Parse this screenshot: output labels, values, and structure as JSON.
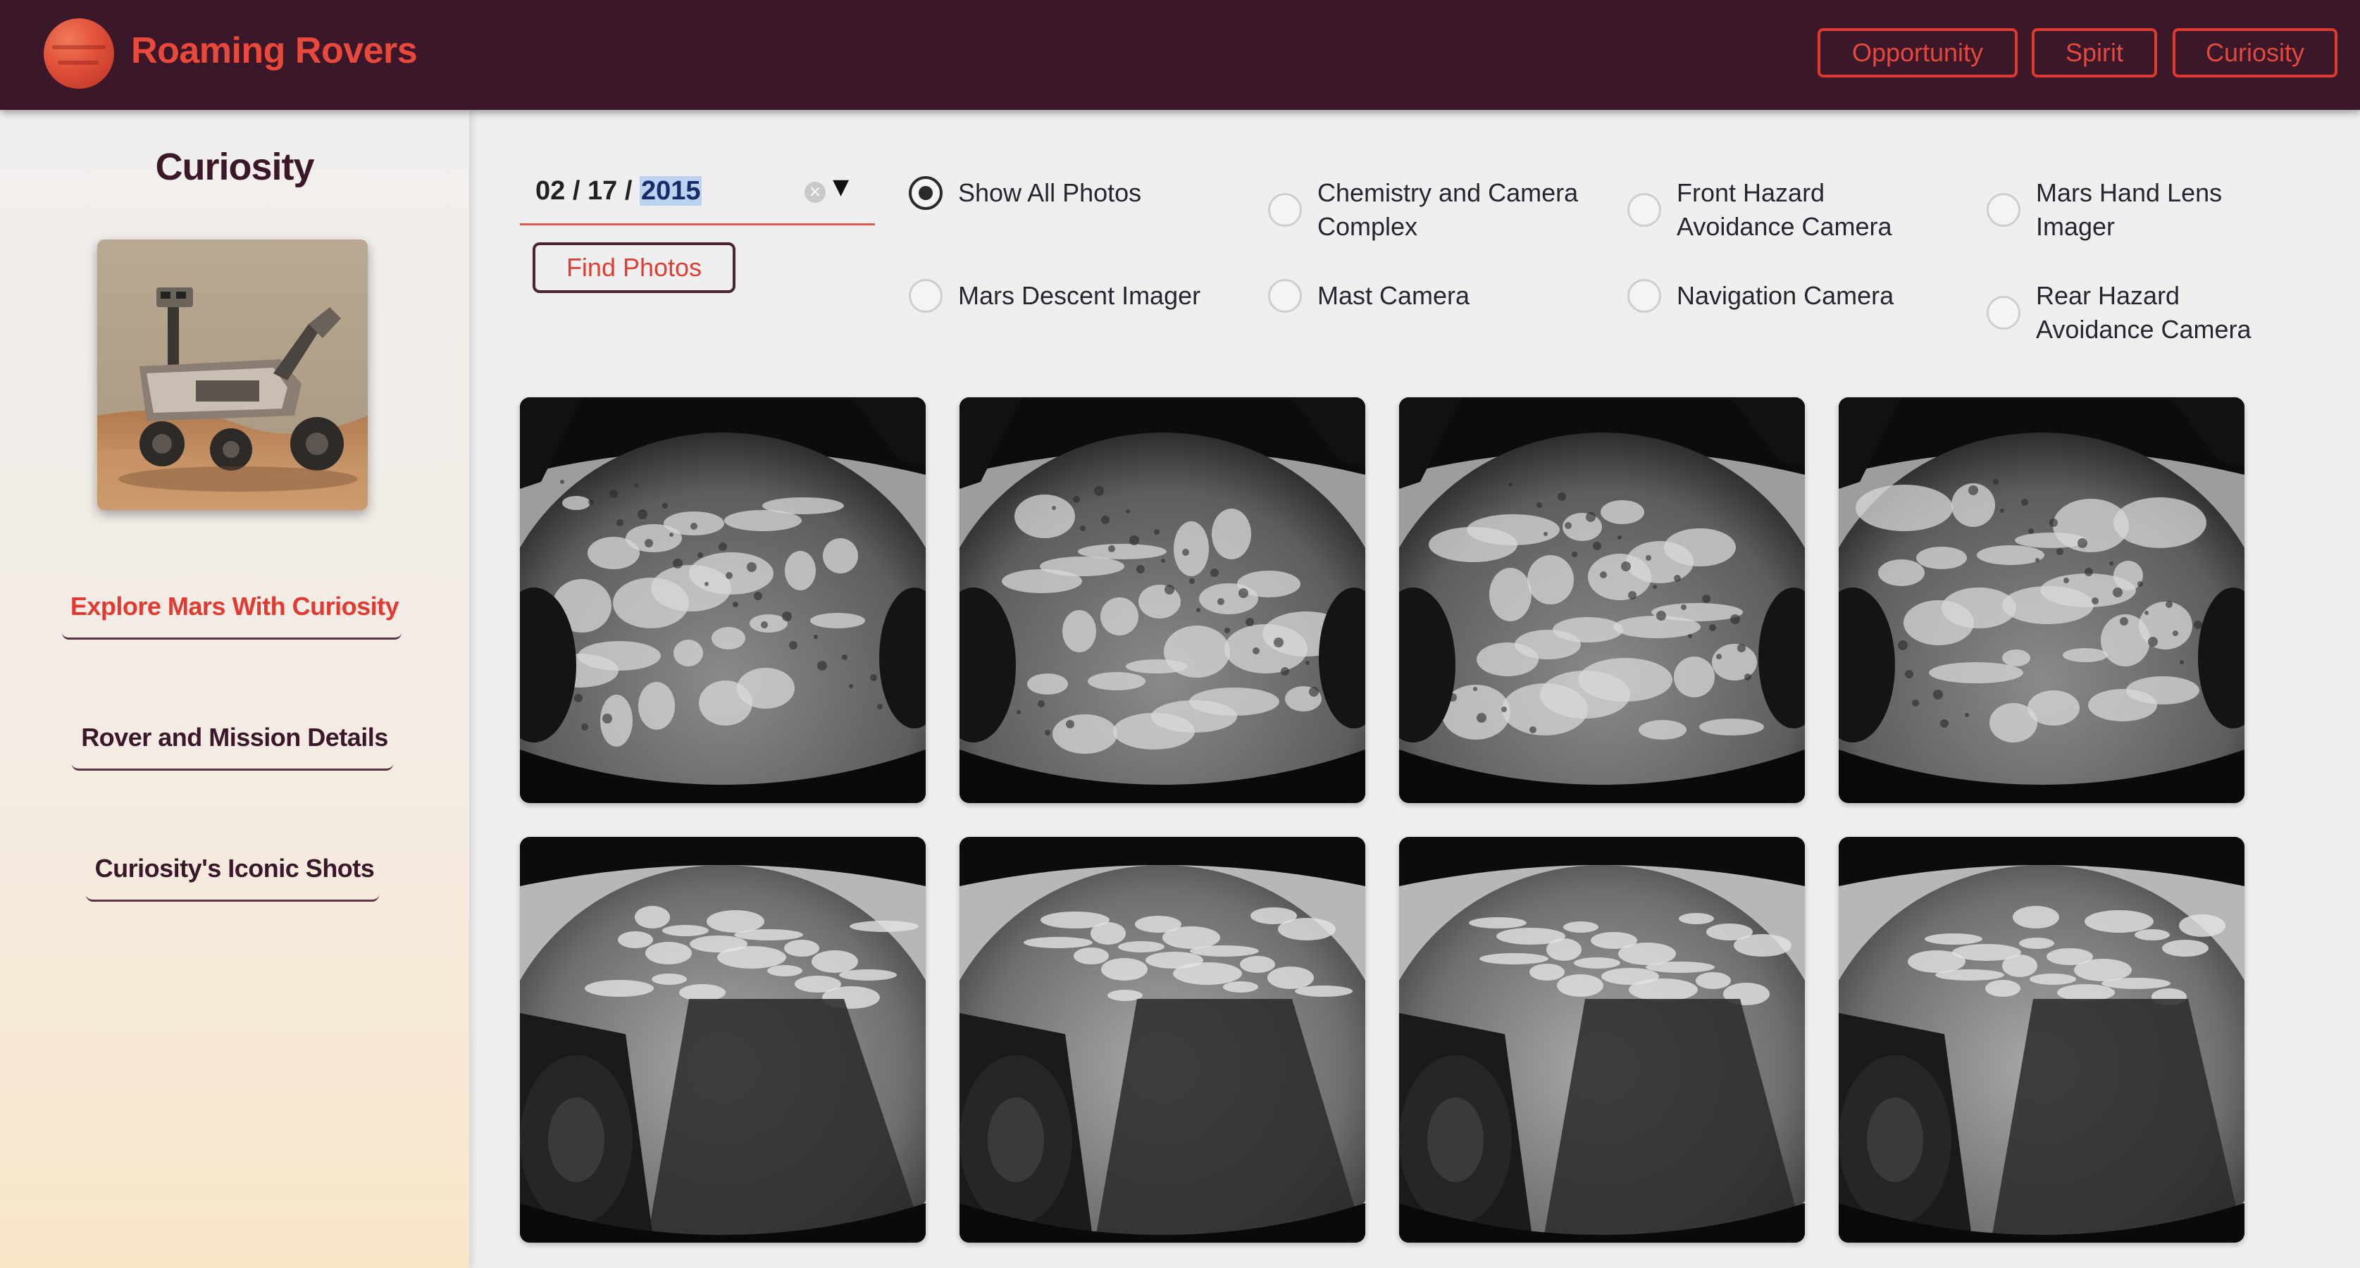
{
  "header": {
    "brand": "Roaming Rovers",
    "logo_icon": "mars-planet-icon",
    "nav": [
      {
        "label": "Opportunity"
      },
      {
        "label": "Spirit"
      },
      {
        "label": "Curiosity"
      }
    ]
  },
  "sidebar": {
    "rover_name": "Curiosity",
    "links": [
      {
        "label": "Explore Mars With Curiosity",
        "active": true
      },
      {
        "label": "Rover and Mission Details",
        "active": false
      },
      {
        "label": "Curiosity's Iconic Shots",
        "active": false
      }
    ]
  },
  "filters": {
    "date": {
      "month": "02",
      "day": "17",
      "year": "2015",
      "separator": "/"
    },
    "find_button": "Find Photos",
    "cameras": [
      {
        "label": "Show All Photos",
        "checked": true
      },
      {
        "label": "Chemistry and Camera Complex",
        "line1": "Chemistry and Camera",
        "line2": "Complex",
        "checked": false
      },
      {
        "label": "Front Hazard Avoidance Camera",
        "line1": "Front Hazard",
        "line2": "Avoidance Camera",
        "checked": false
      },
      {
        "label": "Mars Hand Lens Imager",
        "line1": "Mars Hand Lens",
        "line2": "Imager",
        "checked": false
      },
      {
        "label": "Mars Descent Imager",
        "checked": false
      },
      {
        "label": "Mast Camera",
        "checked": false
      },
      {
        "label": "Navigation Camera",
        "checked": false
      },
      {
        "label": "Rear Hazard Avoidance Camera",
        "line1": "Rear Hazard",
        "line2": "Avoidance Camera",
        "checked": false
      }
    ]
  },
  "photos": [
    {
      "kind": "hazcam-front"
    },
    {
      "kind": "hazcam-front"
    },
    {
      "kind": "hazcam-front"
    },
    {
      "kind": "hazcam-front"
    },
    {
      "kind": "hazcam-rear"
    },
    {
      "kind": "hazcam-rear"
    },
    {
      "kind": "hazcam-rear"
    },
    {
      "kind": "hazcam-rear"
    }
  ],
  "colors": {
    "header_bg": "#3b1829",
    "accent": "#e5483c",
    "dark": "#3b1829"
  }
}
